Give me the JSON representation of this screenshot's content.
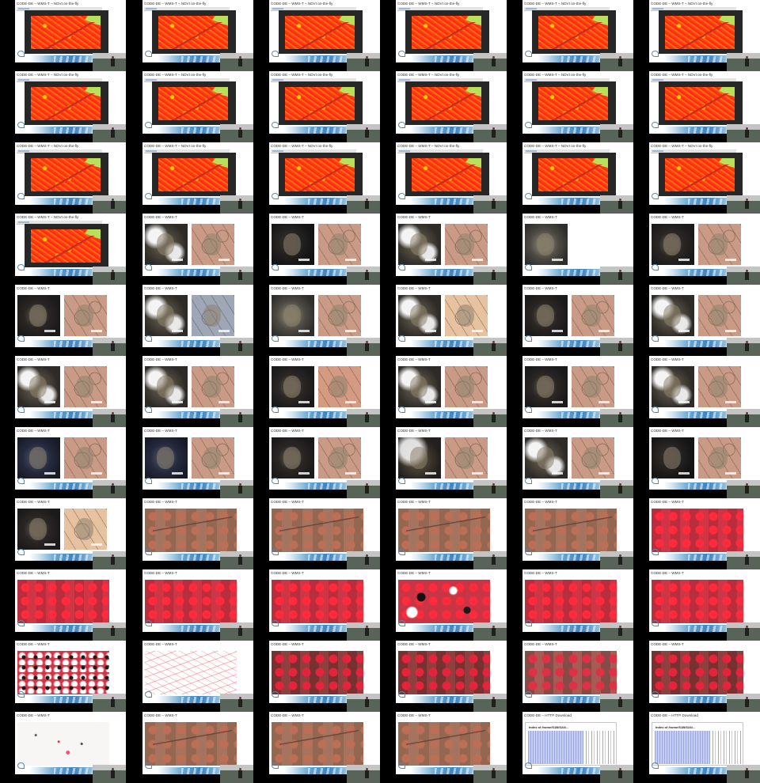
{
  "title_ndvi": "CODE-DE – WMS-T – NDVI on-the-fly",
  "title_wmst": "CODE-DE – WMS-T",
  "title_http": "CODE-DE – HTTP Download",
  "http_index_heading": "Index of /home/S1B/S2A/...",
  "rows": [
    [
      {
        "kind": "ndvi"
      },
      {
        "kind": "ndvi"
      },
      {
        "kind": "ndvi"
      },
      {
        "kind": "ndvi"
      },
      {
        "kind": "ndvi"
      },
      {
        "kind": "ndvi"
      }
    ],
    [
      {
        "kind": "ndvi"
      },
      {
        "kind": "ndvi"
      },
      {
        "kind": "ndvi"
      },
      {
        "kind": "ndvi"
      },
      {
        "kind": "ndvi"
      },
      {
        "kind": "ndvi"
      }
    ],
    [
      {
        "kind": "ndvi"
      },
      {
        "kind": "ndvi"
      },
      {
        "kind": "ndvi"
      },
      {
        "kind": "ndvi"
      },
      {
        "kind": "ndvi"
      },
      {
        "kind": "ndvi"
      }
    ],
    [
      {
        "kind": "ndvi"
      },
      {
        "kind": "pair",
        "left": "cloud",
        "right": "tan"
      },
      {
        "kind": "pair",
        "left": "veryd",
        "right": "tan"
      },
      {
        "kind": "pair",
        "left": "cloud",
        "right": "tan"
      },
      {
        "kind": "pair",
        "left": "grey",
        "right": "none"
      },
      {
        "kind": "pair",
        "left": "dark",
        "right": "tan"
      }
    ],
    [
      {
        "kind": "pair",
        "left": "dark",
        "right": "tan"
      },
      {
        "kind": "pair",
        "left": "cloud",
        "right": "bluish"
      },
      {
        "kind": "pair",
        "left": "grey",
        "right": "tan"
      },
      {
        "kind": "pair",
        "left": "cloud",
        "right": "pale"
      },
      {
        "kind": "pair",
        "left": "dark",
        "right": "tan"
      },
      {
        "kind": "pair",
        "left": "cloud",
        "right": "tan"
      }
    ],
    [
      {
        "kind": "pair",
        "left": "cloud",
        "right": "tan"
      },
      {
        "kind": "pair",
        "left": "cloud",
        "right": "tan"
      },
      {
        "kind": "pair",
        "left": "dark",
        "right": "rtan"
      },
      {
        "kind": "pair",
        "left": "cloud",
        "right": "tan"
      },
      {
        "kind": "pair",
        "left": "dark",
        "right": "tan"
      },
      {
        "kind": "pair",
        "left": "cloud",
        "right": "tan"
      }
    ],
    [
      {
        "kind": "pair",
        "left": "navy",
        "right": "tan"
      },
      {
        "kind": "pair",
        "left": "navy",
        "right": "tan"
      },
      {
        "kind": "pair",
        "left": "dark",
        "right": "tan"
      },
      {
        "kind": "pair",
        "left": "mist",
        "right": "tan"
      },
      {
        "kind": "pair",
        "left": "cloud",
        "right": "tan"
      },
      {
        "kind": "pair",
        "left": "veryd",
        "right": "tan"
      }
    ],
    [
      {
        "kind": "pair",
        "left": "dark",
        "right": "pale"
      },
      {
        "kind": "wide",
        "style": "brown"
      },
      {
        "kind": "wide",
        "style": "brown"
      },
      {
        "kind": "wide",
        "style": "brown"
      },
      {
        "kind": "wide",
        "style": "brown"
      },
      {
        "kind": "wide",
        "style": "red"
      }
    ],
    [
      {
        "kind": "wide",
        "style": "red"
      },
      {
        "kind": "wide",
        "style": "red"
      },
      {
        "kind": "wide",
        "style": "red"
      },
      {
        "kind": "wide",
        "style": "patchy"
      },
      {
        "kind": "wide",
        "style": "red"
      },
      {
        "kind": "wide",
        "style": "red"
      }
    ],
    [
      {
        "kind": "wide",
        "style": "spotted"
      },
      {
        "kind": "wide",
        "style": "whiteout"
      },
      {
        "kind": "wide",
        "style": "dkred"
      },
      {
        "kind": "wide",
        "style": "dkred"
      },
      {
        "kind": "wide",
        "style": "mixed"
      },
      {
        "kind": "wide",
        "style": "dkred"
      }
    ],
    [
      {
        "kind": "wide",
        "style": "sparse"
      },
      {
        "kind": "wide",
        "style": "brown"
      },
      {
        "kind": "wide",
        "style": "brown"
      },
      {
        "kind": "wide",
        "style": "brown"
      },
      {
        "kind": "http"
      },
      {
        "kind": "http"
      }
    ]
  ]
}
